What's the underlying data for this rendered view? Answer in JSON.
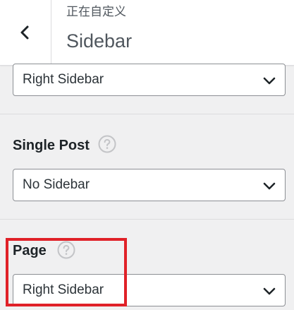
{
  "header": {
    "subtitle": "正在自定义",
    "title": "Sidebar",
    "back_icon": "chevron-left-icon"
  },
  "settings": [
    {
      "label": "",
      "selected": "Right Sidebar"
    },
    {
      "label": "Single Post",
      "selected": "No Sidebar"
    },
    {
      "label": "Page",
      "selected": "Right Sidebar"
    }
  ],
  "colors": {
    "highlight": "#e02128",
    "panel_bg": "#f0f0f1"
  }
}
